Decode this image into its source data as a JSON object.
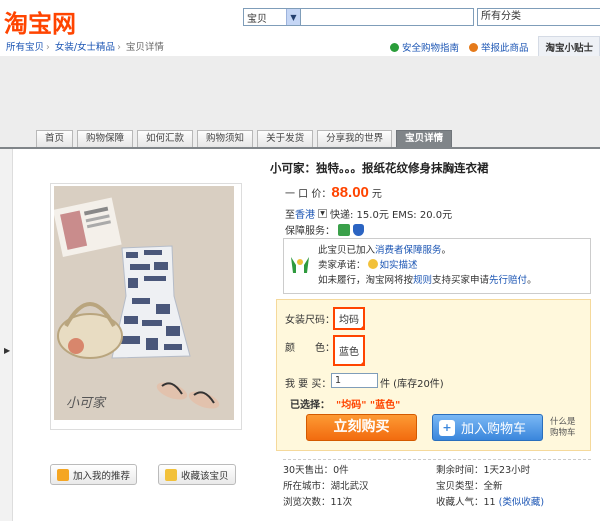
{
  "header": {
    "logo_text": "淘宝网",
    "search_scope": "宝贝",
    "search_value": "",
    "category": "所有分类"
  },
  "breadcrumb": [
    "所有宝贝",
    "女装/女士精品",
    "宝贝详情"
  ],
  "top_links": {
    "safe_guide": "安全购物指南",
    "report": "举报此商品",
    "tips": "淘宝小贴士"
  },
  "tabs": [
    "首页",
    "购物保障",
    "如何汇款",
    "购物须知",
    "关于发货",
    "分享我的世界",
    "宝贝详情"
  ],
  "product": {
    "title": "小可家：独特。。。报纸花纹修身抹胸连衣裙",
    "price_label": "一 口 价：",
    "price": "88.00",
    "price_unit": "元",
    "ship_to_prefix": "至",
    "ship_to": "香港",
    "ship_rates": "快递: 15.0元  EMS: 20.0元",
    "service_label": "保障服务：",
    "image_caption": "小可家"
  },
  "guarantee": {
    "line1_pre": "此宝贝已加入",
    "line1_link": "消费者保障服务",
    "line1_post": "。",
    "line2_label": "卖家承诺：",
    "line2_link": "如实描述",
    "line3_pre": "如未履行，淘宝网将按",
    "line3_link1": "规则",
    "line3_mid": "支持买家申请",
    "line3_link2": "先行赔付",
    "line3_post": "。"
  },
  "buy": {
    "size_label": "女装尺码：",
    "size_value": "均码",
    "color_label": "颜　　色：",
    "color_value": "蓝色",
    "qty_label": "我 要 买：",
    "qty_value": "1",
    "qty_unit": "件 (库存20件)",
    "selected_label": "已选择：",
    "selected_value": "\"均码\" \"蓝色\"",
    "buy_now": "立刻购买",
    "add_cart": "加入购物车",
    "what_is_cart": "什么是\n购物车"
  },
  "actions": {
    "recommend": "加入我的推荐",
    "favorite": "收藏该宝贝"
  },
  "stats": {
    "sold_30": "30天售出：0件",
    "remaining": "剩余时间：1天23小时",
    "city": "所在城市：湖北武汉",
    "type": "宝贝类型：全新",
    "views": "浏览次数：11次",
    "popularity_label": "收藏人气：",
    "popularity_value": "11",
    "popularity_link": "(类似收藏)"
  },
  "colors": {
    "accent": "#ff4400",
    "link": "#1c56b4",
    "buy_button": "#f26b0f",
    "cart_button": "#3a86dc"
  }
}
